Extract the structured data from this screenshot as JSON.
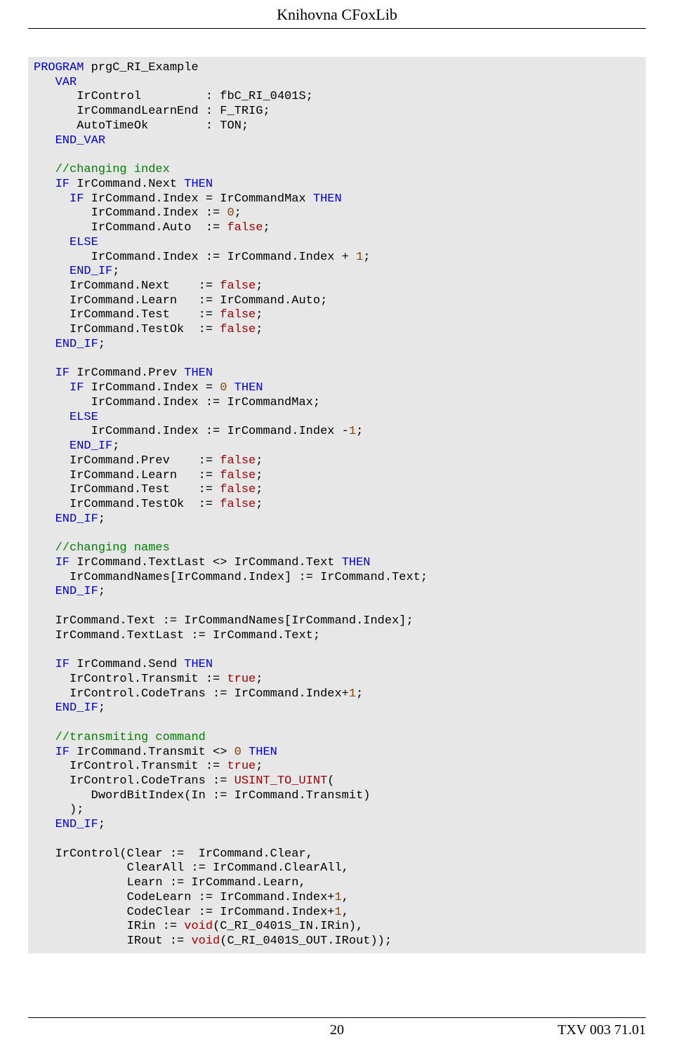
{
  "page_header": "Knihovna CFoxLib",
  "footer": {
    "page_num": "20",
    "doc_ref": "TXV 003 71.01"
  },
  "code_lines": [
    [
      {
        "t": "PROGRAM",
        "c": "c-blue"
      },
      {
        "t": " prgC_RI_Example"
      }
    ],
    [
      {
        "t": "   "
      },
      {
        "t": "VAR",
        "c": "c-blue"
      }
    ],
    [
      {
        "t": "      IrControl         : fbC_RI_0401S;"
      }
    ],
    [
      {
        "t": "      IrCommandLearnEnd : F_TRIG;"
      }
    ],
    [
      {
        "t": "      AutoTimeOk        : TON;"
      }
    ],
    [
      {
        "t": "   "
      },
      {
        "t": "END_VAR",
        "c": "c-blue"
      }
    ],
    [
      {
        "t": " "
      }
    ],
    [
      {
        "t": "   "
      },
      {
        "t": "//changing index",
        "c": "c-green"
      }
    ],
    [
      {
        "t": "   "
      },
      {
        "t": "IF",
        "c": "c-blue"
      },
      {
        "t": " IrCommand.Next "
      },
      {
        "t": "THEN",
        "c": "c-blue"
      }
    ],
    [
      {
        "t": "     "
      },
      {
        "t": "IF",
        "c": "c-blue"
      },
      {
        "t": " IrCommand.Index = IrCommandMax "
      },
      {
        "t": "THEN",
        "c": "c-blue"
      }
    ],
    [
      {
        "t": "        IrCommand.Index := "
      },
      {
        "t": "0",
        "c": "c-brown"
      },
      {
        "t": ";"
      }
    ],
    [
      {
        "t": "        IrCommand.Auto  := "
      },
      {
        "t": "false",
        "c": "c-red"
      },
      {
        "t": ";"
      }
    ],
    [
      {
        "t": "     "
      },
      {
        "t": "ELSE",
        "c": "c-blue"
      }
    ],
    [
      {
        "t": "        IrCommand.Index := IrCommand.Index + "
      },
      {
        "t": "1",
        "c": "c-brown"
      },
      {
        "t": ";"
      }
    ],
    [
      {
        "t": "     "
      },
      {
        "t": "END_IF",
        "c": "c-blue"
      },
      {
        "t": ";"
      }
    ],
    [
      {
        "t": "     IrCommand.Next    := "
      },
      {
        "t": "false",
        "c": "c-red"
      },
      {
        "t": ";"
      }
    ],
    [
      {
        "t": "     IrCommand.Learn   := IrCommand.Auto;"
      }
    ],
    [
      {
        "t": "     IrCommand.Test    := "
      },
      {
        "t": "false",
        "c": "c-red"
      },
      {
        "t": ";"
      }
    ],
    [
      {
        "t": "     IrCommand.TestOk  := "
      },
      {
        "t": "false",
        "c": "c-red"
      },
      {
        "t": ";"
      }
    ],
    [
      {
        "t": "   "
      },
      {
        "t": "END_IF",
        "c": "c-blue"
      },
      {
        "t": ";"
      }
    ],
    [
      {
        "t": " "
      }
    ],
    [
      {
        "t": "   "
      },
      {
        "t": "IF",
        "c": "c-blue"
      },
      {
        "t": " IrCommand.Prev "
      },
      {
        "t": "THEN",
        "c": "c-blue"
      }
    ],
    [
      {
        "t": "     "
      },
      {
        "t": "IF",
        "c": "c-blue"
      },
      {
        "t": " IrCommand.Index = "
      },
      {
        "t": "0",
        "c": "c-brown"
      },
      {
        "t": " "
      },
      {
        "t": "THEN",
        "c": "c-blue"
      }
    ],
    [
      {
        "t": "        IrCommand.Index := IrCommandMax;"
      }
    ],
    [
      {
        "t": "     "
      },
      {
        "t": "ELSE",
        "c": "c-blue"
      }
    ],
    [
      {
        "t": "        IrCommand.Index := IrCommand.Index -"
      },
      {
        "t": "1",
        "c": "c-brown"
      },
      {
        "t": ";"
      }
    ],
    [
      {
        "t": "     "
      },
      {
        "t": "END_IF",
        "c": "c-blue"
      },
      {
        "t": ";"
      }
    ],
    [
      {
        "t": "     IrCommand.Prev    := "
      },
      {
        "t": "false",
        "c": "c-red"
      },
      {
        "t": ";"
      }
    ],
    [
      {
        "t": "     IrCommand.Learn   := "
      },
      {
        "t": "false",
        "c": "c-red"
      },
      {
        "t": ";"
      }
    ],
    [
      {
        "t": "     IrCommand.Test    := "
      },
      {
        "t": "false",
        "c": "c-red"
      },
      {
        "t": ";"
      }
    ],
    [
      {
        "t": "     IrCommand.TestOk  := "
      },
      {
        "t": "false",
        "c": "c-red"
      },
      {
        "t": ";"
      }
    ],
    [
      {
        "t": "   "
      },
      {
        "t": "END_IF",
        "c": "c-blue"
      },
      {
        "t": ";"
      }
    ],
    [
      {
        "t": " "
      }
    ],
    [
      {
        "t": "   "
      },
      {
        "t": "//changing names",
        "c": "c-green"
      }
    ],
    [
      {
        "t": "   "
      },
      {
        "t": "IF",
        "c": "c-blue"
      },
      {
        "t": " IrCommand.TextLast <> IrCommand.Text "
      },
      {
        "t": "THEN",
        "c": "c-blue"
      }
    ],
    [
      {
        "t": "     IrCommandNames[IrCommand.Index] := IrCommand.Text;"
      }
    ],
    [
      {
        "t": "   "
      },
      {
        "t": "END_IF",
        "c": "c-blue"
      },
      {
        "t": ";"
      }
    ],
    [
      {
        "t": " "
      }
    ],
    [
      {
        "t": "   IrCommand.Text := IrCommandNames[IrCommand.Index];"
      }
    ],
    [
      {
        "t": "   IrCommand.TextLast := IrCommand.Text;"
      }
    ],
    [
      {
        "t": " "
      }
    ],
    [
      {
        "t": "   "
      },
      {
        "t": "IF",
        "c": "c-blue"
      },
      {
        "t": " IrCommand.Send "
      },
      {
        "t": "THEN",
        "c": "c-blue"
      }
    ],
    [
      {
        "t": "     IrControl.Transmit := "
      },
      {
        "t": "true",
        "c": "c-red"
      },
      {
        "t": ";"
      }
    ],
    [
      {
        "t": "     IrControl.CodeTrans := IrCommand.Index+"
      },
      {
        "t": "1",
        "c": "c-brown"
      },
      {
        "t": ";"
      }
    ],
    [
      {
        "t": "   "
      },
      {
        "t": "END_IF",
        "c": "c-blue"
      },
      {
        "t": ";"
      }
    ],
    [
      {
        "t": " "
      }
    ],
    [
      {
        "t": "   "
      },
      {
        "t": "//transmiting command",
        "c": "c-green"
      }
    ],
    [
      {
        "t": "   "
      },
      {
        "t": "IF",
        "c": "c-blue"
      },
      {
        "t": " IrCommand.Transmit <> "
      },
      {
        "t": "0",
        "c": "c-brown"
      },
      {
        "t": " "
      },
      {
        "t": "THEN",
        "c": "c-blue"
      }
    ],
    [
      {
        "t": "     IrControl.Transmit := "
      },
      {
        "t": "true",
        "c": "c-red"
      },
      {
        "t": ";"
      }
    ],
    [
      {
        "t": "     IrControl.CodeTrans := "
      },
      {
        "t": "USINT_TO_UINT",
        "c": "c-red"
      },
      {
        "t": "("
      }
    ],
    [
      {
        "t": "        DwordBitIndex(In := IrCommand.Transmit)"
      }
    ],
    [
      {
        "t": "     );"
      }
    ],
    [
      {
        "t": "   "
      },
      {
        "t": "END_IF",
        "c": "c-blue"
      },
      {
        "t": ";"
      }
    ],
    [
      {
        "t": " "
      }
    ],
    [
      {
        "t": "   IrControl(Clear :=  IrCommand.Clear,"
      }
    ],
    [
      {
        "t": "             ClearAll := IrCommand.ClearAll,"
      }
    ],
    [
      {
        "t": "             Learn := IrCommand.Learn,"
      }
    ],
    [
      {
        "t": "             CodeLearn := IrCommand.Index+"
      },
      {
        "t": "1",
        "c": "c-brown"
      },
      {
        "t": ","
      }
    ],
    [
      {
        "t": "             CodeClear := IrCommand.Index+"
      },
      {
        "t": "1",
        "c": "c-brown"
      },
      {
        "t": ","
      }
    ],
    [
      {
        "t": "             IRin := "
      },
      {
        "t": "void",
        "c": "c-red"
      },
      {
        "t": "(C_RI_0401S_IN.IRin),"
      }
    ],
    [
      {
        "t": "             IRout := "
      },
      {
        "t": "void",
        "c": "c-red"
      },
      {
        "t": "(C_RI_0401S_OUT.IRout));"
      }
    ]
  ]
}
